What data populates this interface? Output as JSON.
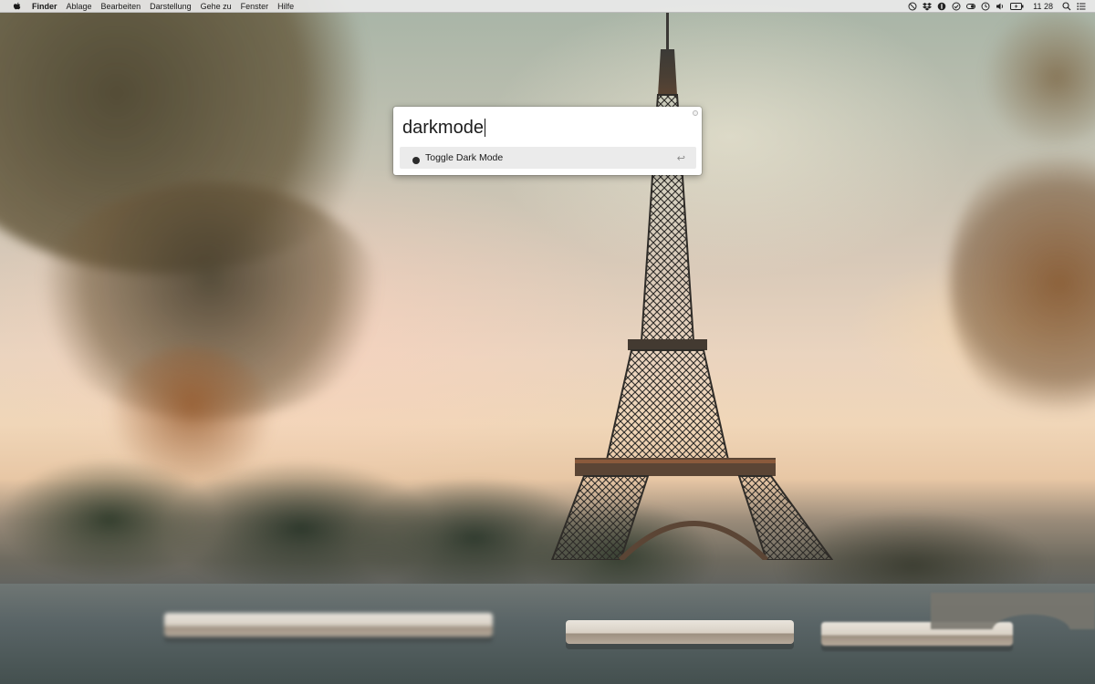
{
  "menubar": {
    "apple_icon": "apple-icon",
    "app_name": "Finder",
    "menus": [
      "Ablage",
      "Bearbeiten",
      "Darstellung",
      "Gehe zu",
      "Fenster",
      "Hilfe"
    ],
    "status_icons": [
      "do-not-disturb-icon",
      "dropbox-icon",
      "1password-icon",
      "sync-icon",
      "toggle-icon",
      "time-machine-icon",
      "volume-icon",
      "battery-icon"
    ],
    "clock": "11 28",
    "right_icons": [
      "spotlight-icon",
      "notification-center-icon"
    ]
  },
  "launcher": {
    "query": "darkmode",
    "results": [
      {
        "title": "Toggle Dark Mode",
        "action_icon": "return-icon",
        "action_glyph": "↩"
      }
    ]
  },
  "wallpaper": {
    "subject": "eiffel-tower"
  }
}
